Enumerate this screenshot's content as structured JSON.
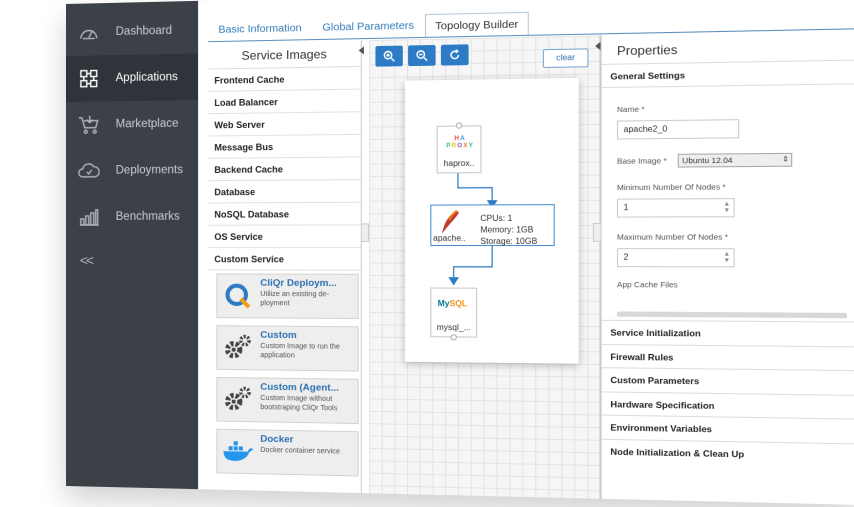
{
  "nav": {
    "items": [
      {
        "label": "Dashboard",
        "icon": "dashboard-gauge-icon"
      },
      {
        "label": "Applications",
        "icon": "applications-grid-icon"
      },
      {
        "label": "Marketplace",
        "icon": "marketplace-cart-icon"
      },
      {
        "label": "Deployments",
        "icon": "deployments-cloud-icon"
      },
      {
        "label": "Benchmarks",
        "icon": "benchmarks-bars-icon"
      }
    ],
    "collapse": "<<"
  },
  "tabs": [
    "Basic Information",
    "Global Parameters",
    "Topology Builder"
  ],
  "service_images": {
    "title": "Service Images",
    "categories": [
      "Frontend Cache",
      "Load Balancer",
      "Web Server",
      "Message Bus",
      "Backend Cache",
      "Database",
      "NoSQL Database",
      "OS Service",
      "Custom Service"
    ],
    "cards": [
      {
        "title": "CliQr Deploym...",
        "desc": "Utilize an existing de-ployment"
      },
      {
        "title": "Custom",
        "desc": "Custom Image to run the application"
      },
      {
        "title": "Custom (Agent...",
        "desc": "Custom Image without bootstraping CliQr Tools"
      },
      {
        "title": "Docker",
        "desc": "Docker container service"
      }
    ]
  },
  "canvas": {
    "clear_label": "clear",
    "nodes": [
      {
        "label": "haprox..",
        "logo": "HA PROXY"
      },
      {
        "label": "apache..",
        "specs": [
          "CPUs: 1",
          "Memory: 1GB",
          "Storage: 10GB"
        ]
      },
      {
        "label": "mysql_...",
        "logo": "MySQL"
      }
    ]
  },
  "properties": {
    "title": "Properties",
    "general_settings": "General Settings",
    "name_label": "Name *",
    "name_value": "apache2_0",
    "base_image_label": "Base Image *",
    "base_image_value": "Ubuntu 12.04",
    "min_nodes_label": "Minimum Number Of Nodes *",
    "min_nodes_value": "1",
    "max_nodes_label": "Maximum Number Of Nodes *",
    "max_nodes_value": "2",
    "cut_label": "App Cache Files",
    "sections": [
      "Service Initialization",
      "Firewall Rules",
      "Custom Parameters",
      "Hardware Specification",
      "Environment Variables",
      "Node Initialization & Clean Up"
    ]
  },
  "colors": {
    "nav_bg": "#3c4148",
    "accent": "#2d7bc4",
    "link": "#2c6fb1"
  }
}
